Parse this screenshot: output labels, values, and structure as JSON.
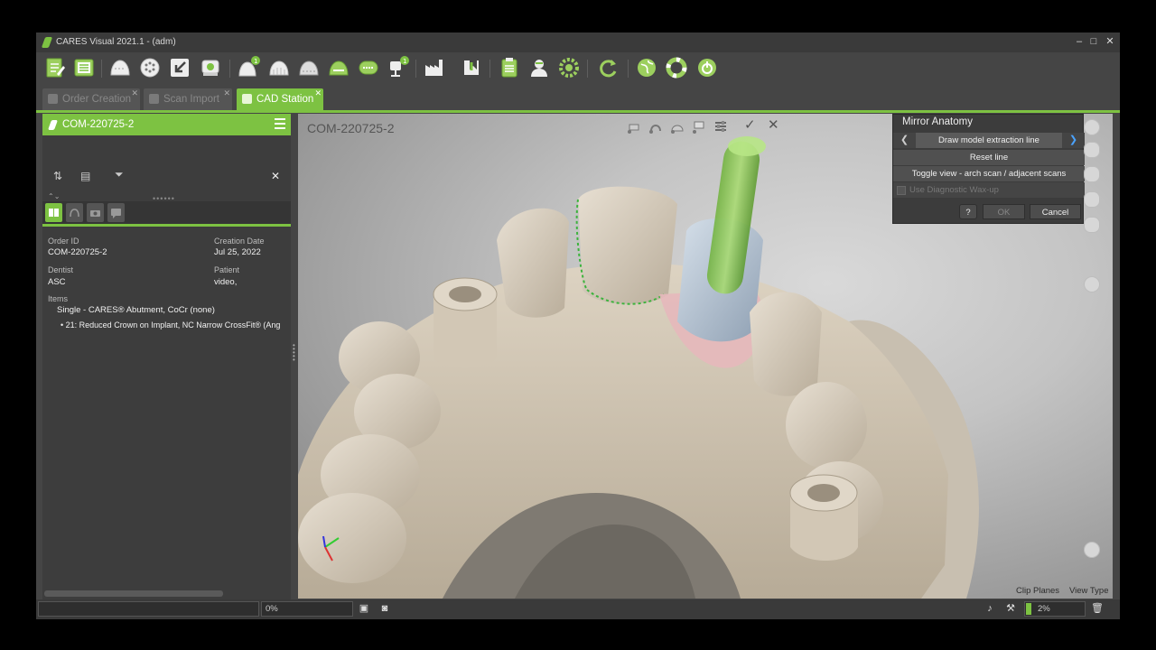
{
  "window": {
    "title": "CARES Visual 2021.1 - (adm)",
    "minimize": "–",
    "maximize": "□",
    "close": "✕"
  },
  "toolbar": {
    "badge1": "1",
    "badge2": "1",
    "icons": [
      "new-order-icon",
      "order-list-icon",
      "scan-icon",
      "scan-dots-icon",
      "import-icon",
      "scanner-icon",
      "crown-badge-icon",
      "crown-icon",
      "crown-outline-icon",
      "bridge-icon",
      "jaw-icon",
      "tree-badge-icon",
      "factory-icon",
      "export-icon",
      "clipboard-icon",
      "user-icon",
      "settings-gear-icon",
      "refresh-icon",
      "globe-icon",
      "help-lifebuoy-icon",
      "power-icon"
    ]
  },
  "tabs": [
    {
      "label": "Order Creation",
      "close": "✕",
      "active": false
    },
    {
      "label": "Scan Import",
      "close": "✕",
      "active": false
    },
    {
      "label": "CAD Station",
      "close": "✕",
      "active": true
    }
  ],
  "left_panel": {
    "header": "COM-220725-2",
    "close": "✕",
    "grip": "••••••",
    "fields": {
      "order_id_label": "Order ID",
      "order_id": "COM-220725-2",
      "creation_date_label": "Creation Date",
      "creation_date": "Jul 25, 2022",
      "dentist_label": "Dentist",
      "dentist": "ASC",
      "patient_label": "Patient",
      "patient": "video,",
      "items_label": "Items",
      "item1": "Single - CARES® Abutment, CoCr (none)",
      "item2": "•  21: Reduced Crown on Implant, NC Narrow CrossFit® (Ang"
    }
  },
  "viewport": {
    "title": "COM-220725-2",
    "check": "✓",
    "close": "✕",
    "clip_planes": "Clip Planes",
    "view_type": "View Type"
  },
  "mirror_anatomy": {
    "title": "Mirror Anatomy",
    "draw_line": "Draw model extraction line",
    "reset_line": "Reset line",
    "toggle_view": "Toggle view - arch scan / adjacent scans",
    "use_wax": "Use Diagnostic Wax-up",
    "help": "?",
    "ok": "OK",
    "cancel": "Cancel",
    "prev": "❮",
    "next": "❯"
  },
  "status": {
    "progress_left": "0%",
    "zoom": "2%",
    "zoom_level": 0.02
  },
  "colors": {
    "accent": "#7dc242",
    "background": "#454545"
  }
}
